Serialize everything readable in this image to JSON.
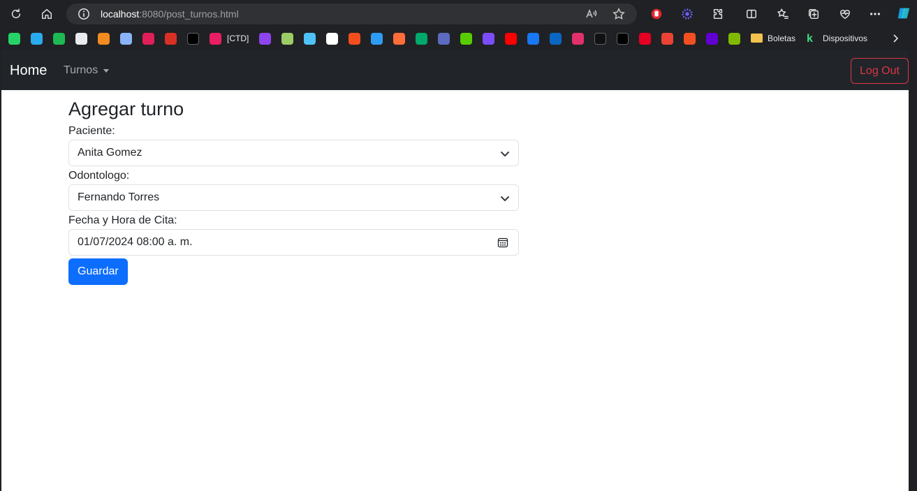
{
  "browser": {
    "url_host": "localhost",
    "url_rest": ":8080/post_turnos.html",
    "bookmarks": [
      {
        "name": "whatsapp",
        "color": "#25d366"
      },
      {
        "name": "telegram",
        "color": "#2aabee"
      },
      {
        "name": "spotify",
        "color": "#1db954"
      },
      {
        "name": "chatgpt",
        "color": "#e8eaed"
      },
      {
        "name": "gmail-m",
        "color": "#f28b20"
      },
      {
        "name": "gemini",
        "color": "#8ab4f8"
      },
      {
        "name": "slack",
        "color": "#e01e5a"
      },
      {
        "name": "onek",
        "color": "#d93025"
      },
      {
        "name": "dm",
        "color": "#000000"
      },
      {
        "name": "ctd",
        "color": "#e91e63"
      },
      {
        "name": "proton",
        "color": "#8e44ef"
      },
      {
        "name": "green-diamond",
        "color": "#9ccc65"
      },
      {
        "name": "window",
        "color": "#4fc3f7"
      },
      {
        "name": "github",
        "color": "#ffffff"
      },
      {
        "name": "figma",
        "color": "#f24e1e"
      },
      {
        "name": "vscode",
        "color": "#2f9cf4"
      },
      {
        "name": "orange-circle",
        "color": "#ff6d3a"
      },
      {
        "name": "chat-green",
        "color": "#00a86b"
      },
      {
        "name": "r-icon",
        "color": "#5c6bc0"
      },
      {
        "name": "duolingo",
        "color": "#58cc02"
      },
      {
        "name": "s-purple",
        "color": "#7c4dff"
      },
      {
        "name": "youtube",
        "color": "#ff0000"
      },
      {
        "name": "facebook",
        "color": "#1877f2"
      },
      {
        "name": "linkedin",
        "color": "#0a66c2"
      },
      {
        "name": "instagram",
        "color": "#e1306c"
      },
      {
        "name": "tiktok",
        "color": "#111111"
      },
      {
        "name": "x",
        "color": "#000000"
      },
      {
        "name": "pinterest",
        "color": "#e60023"
      },
      {
        "name": "gmail",
        "color": "#ea4335"
      },
      {
        "name": "microsoft",
        "color": "#f25022"
      },
      {
        "name": "yahoo-mail",
        "color": "#6001d2"
      },
      {
        "name": "microsoft-2",
        "color": "#7fba00"
      }
    ],
    "bm_ctd_label": "[CTD]",
    "bm_boletas_label": "Boletas",
    "bm_dispositivos_label": "Dispositivos"
  },
  "navbar": {
    "brand": "Home",
    "dropdown": "Turnos",
    "logout": "Log Out"
  },
  "form": {
    "title": "Agregar turno",
    "paciente_label": "Paciente:",
    "paciente_value": "Anita Gomez",
    "odontologo_label": "Odontologo:",
    "odontologo_value": "Fernando Torres",
    "fecha_label": "Fecha y Hora de Cita:",
    "fecha_value": "01/07/2024 08:00  a. m.",
    "submit": "Guardar"
  },
  "colors": {
    "navbar_bg": "#212529",
    "primary": "#0d6efd",
    "danger": "#dc3545"
  }
}
